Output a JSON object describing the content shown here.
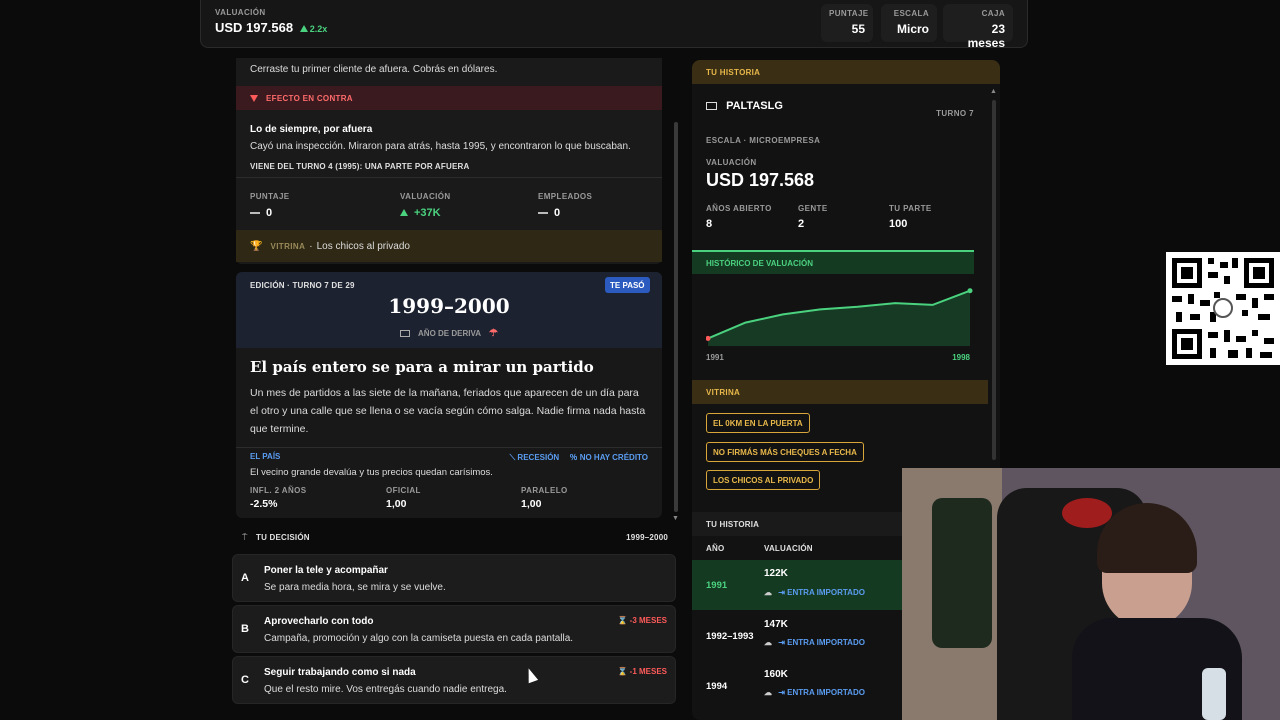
{
  "topbar": {
    "valuation_label": "VALUACIÓN",
    "valuation_value": "USD 197.568",
    "valuation_change": "2.2x",
    "stats": [
      {
        "label": "PUNTAJE",
        "value": "55"
      },
      {
        "label": "ESCALA",
        "value": "Micro"
      },
      {
        "label": "CAJA",
        "value": "23 meses"
      }
    ]
  },
  "effect": {
    "intro": "Cerraste tu primer cliente de afuera. Cobrás en dólares.",
    "badge": "EFECTO EN CONTRA",
    "title": "Lo de siempre, por afuera",
    "text": "Cayó una inspección. Miraron para atrás, hasta 1995, y encontraron lo que buscaban.",
    "origin": "VIENE DEL TURNO 4 (1995): UNA PARTE POR AFUERA",
    "metrics": [
      {
        "label": "PUNTAJE",
        "value": "0"
      },
      {
        "label": "VALUACIÓN",
        "value": "+37K"
      },
      {
        "label": "EMPLEADOS",
        "value": "0"
      }
    ],
    "vitrina_label": "VITRINA",
    "vitrina_text": "Los chicos al privado"
  },
  "edition": {
    "label": "EDICIÓN · TURNO 7 DE 29",
    "badge": "TE PASÓ",
    "years": "1999–2000",
    "subtitle": "AÑO DE DERIVA",
    "headline": "El país entero se para a mirar un partido",
    "body": "Un mes de partidos a las siete de la mañana, feriados que aparecen de un día para el otro y una calle que se llena o se vacía según cómo salga. Nadie firma nada hasta que termine.",
    "country_label": "EL PAÍS",
    "tags": [
      "RECESIÓN",
      "NO HAY CRÉDITO"
    ],
    "country_text": "El vecino grande devalúa y tus precios quedan carísimos.",
    "indicators": [
      {
        "label": "INFL. 2 AÑOS",
        "value": "-2.5%"
      },
      {
        "label": "OFICIAL",
        "value": "1,00"
      },
      {
        "label": "PARALELO",
        "value": "1,00"
      }
    ]
  },
  "decision": {
    "label": "TU DECISIÓN",
    "years": "1999–2000",
    "options": [
      {
        "letter": "A",
        "title": "Poner la tele y acompañar",
        "desc": "Se para media hora, se mira y se vuelve.",
        "cost": ""
      },
      {
        "letter": "B",
        "title": "Aprovecharlo con todo",
        "desc": "Campaña, promoción y algo con la camiseta puesta en cada pantalla.",
        "cost": "-3 MESES"
      },
      {
        "letter": "C",
        "title": "Seguir trabajando como si nada",
        "desc": "Que el resto mire. Vos entregás cuando nadie entrega.",
        "cost": "-1 MESES"
      }
    ]
  },
  "history": {
    "header": "TU HISTORIA",
    "company": "PALTASLG",
    "turn": "TURNO 7",
    "scale": "ESCALA · MICROEMPRESA",
    "valuation_label": "VALUACIÓN",
    "valuation_value": "USD 197.568",
    "stats": [
      {
        "label": "AÑOS ABIERTO",
        "value": "8"
      },
      {
        "label": "GENTE",
        "value": "2"
      },
      {
        "label": "TU PARTE",
        "value": "100"
      }
    ],
    "chart_label": "HISTÓRICO DE VALUACIÓN",
    "vitrina_label": "VITRINA",
    "vitrina_items": [
      "EL 0KM EN LA PUERTA",
      "NO FIRMÁS MÁS CHEQUES A FECHA",
      "LOS CHICOS AL PRIVADO"
    ],
    "table_label": "TU HISTORIA",
    "table_headers": [
      "AÑO",
      "VALUACIÓN"
    ],
    "rows": [
      {
        "year": "1991",
        "value": "122K",
        "note": "ENTRA IMPORTADO"
      },
      {
        "year": "1992–1993",
        "value": "147K",
        "note": "ENTRA IMPORTADO"
      },
      {
        "year": "1994",
        "value": "160K",
        "note": "ENTRA IMPORTADO"
      }
    ]
  },
  "chart_data": {
    "type": "area",
    "x": [
      1991,
      1992,
      1993,
      1994,
      1995,
      1996,
      1997,
      1998
    ],
    "values": [
      122,
      147,
      160,
      168,
      172,
      178,
      175,
      197.568
    ],
    "tick_labels": [
      "1991",
      "1998"
    ],
    "ylim": [
      110,
      205
    ],
    "grid": false,
    "colors": {
      "line": "#4ad27f",
      "fill": "#163a24"
    }
  }
}
